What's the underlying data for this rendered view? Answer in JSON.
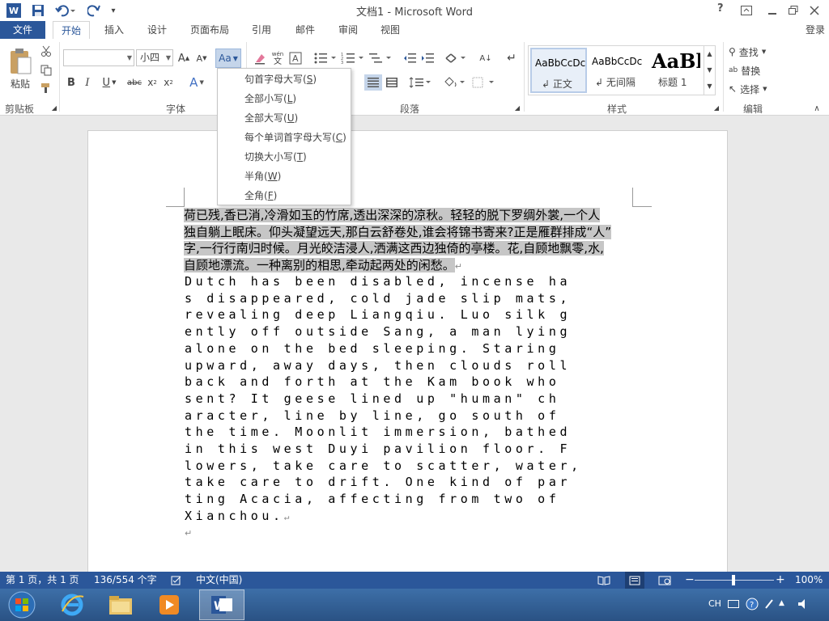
{
  "window": {
    "title": "文档1 - Microsoft Word",
    "help_label": "?",
    "login_label": "登录"
  },
  "tabs": {
    "file": "文件",
    "items": [
      "开始",
      "插入",
      "设计",
      "页面布局",
      "引用",
      "邮件",
      "审阅",
      "视图"
    ]
  },
  "ribbon": {
    "clipboard": {
      "paste_label": "粘贴",
      "group_label": "剪贴板"
    },
    "font": {
      "font_name_value": "",
      "font_size_value": "小四",
      "group_label": "字体",
      "change_case_label": "Aa"
    },
    "paragraph": {
      "group_label": "段落"
    },
    "styles": {
      "group_label": "样式",
      "items": [
        {
          "preview": "AaBbCcDc",
          "name": "正文"
        },
        {
          "preview": "AaBbCcDc",
          "name": "无间隔"
        },
        {
          "preview": "AaBl",
          "name": "标题 1"
        }
      ]
    },
    "editing": {
      "group_label": "编辑",
      "find_label": "查找",
      "replace_label": "替换",
      "select_label": "选择"
    }
  },
  "change_case_menu": {
    "items": [
      {
        "label": "句首字母大写",
        "key": "S"
      },
      {
        "label": "全部小写",
        "key": "L"
      },
      {
        "label": "全部大写",
        "key": "U"
      },
      {
        "label": "每个单词首字母大写",
        "key": "C"
      },
      {
        "label": "切换大小写",
        "key": "T"
      },
      {
        "label": "半角",
        "key": "W"
      },
      {
        "label": "全角",
        "key": "F"
      }
    ]
  },
  "document": {
    "chinese_lines": [
      "荷已残,香已消,冷滑如玉的竹席,透出深深的凉秋。轻轻的脱下罗绸外裳,一个人",
      "独自躺上眠床。仰头凝望远天,那白云舒卷处,谁会将锦书寄来?正是雁群排成“人”",
      "字,一行行南归时候。月光皎洁浸人,洒满这西边独倚的亭楼。花,自顾地飘零,水,",
      "自顾地漂流。一种离别的相思,牵动起两处的闲愁。"
    ],
    "english_lines": [
      "Dutch has been disabled, incense ha",
      "s disappeared, cold jade slip mats,",
      "revealing deep Liangqiu. Luo silk g",
      "ently off outside Sang, a man lying",
      "alone on the bed sleeping. Staring",
      "upward, away days, then clouds roll",
      "back and forth at the Kam book who",
      "sent? It geese lined up \"human\" ch",
      "aracter, line by line, go south of",
      "the time. Moonlit immersion, bathed",
      "in this west Duyi pavilion floor. F",
      "lowers, take care to scatter, water,",
      "take care to drift. One kind of par",
      "ting Acacia, affecting from two of",
      "Xianchou."
    ],
    "paragraph_mark": "↵"
  },
  "status": {
    "page": "第 1 页，共 1 页",
    "words": "136/554 个字",
    "language": "中文(中国)",
    "zoom": "100%"
  },
  "taskbar": {
    "tray_lang": "CH"
  },
  "colors": {
    "accent": "#2b579a",
    "selection": "#c6c6c6"
  }
}
